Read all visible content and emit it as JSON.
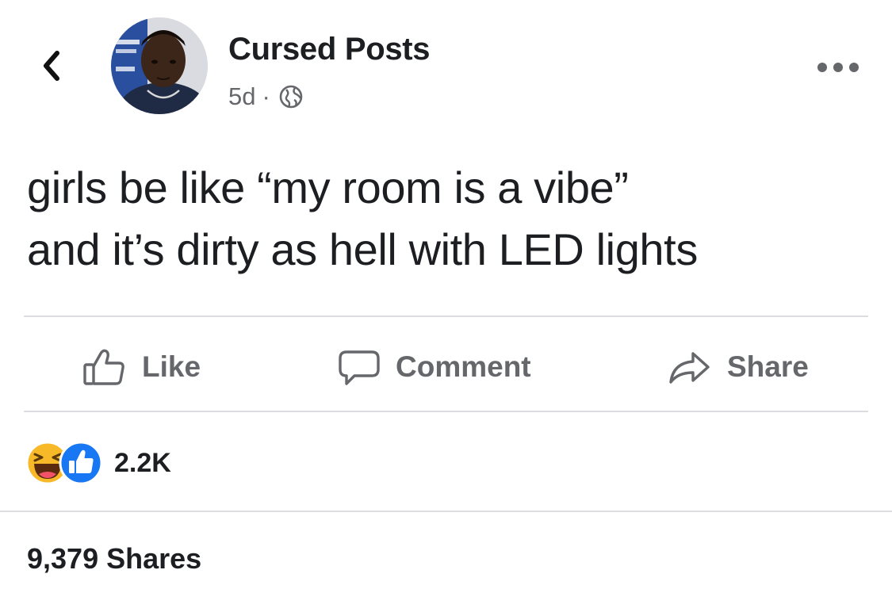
{
  "header": {
    "back_icon": "chevron-left-icon",
    "author_name": "Cursed Posts",
    "time": "5d",
    "separator": "·",
    "privacy_icon": "globe-icon",
    "more_icon": "more-horizontal-icon"
  },
  "post": {
    "text_lines": [
      "girls be like “my room is a vibe”",
      "and it’s dirty as hell with LED lights"
    ]
  },
  "actions": {
    "like": {
      "label": "Like",
      "icon": "thumbs-up-icon"
    },
    "comment": {
      "label": "Comment",
      "icon": "comment-icon"
    },
    "share": {
      "label": "Share",
      "icon": "share-arrow-icon"
    }
  },
  "reactions": {
    "icons": [
      "haha-reaction-icon",
      "like-reaction-icon"
    ],
    "count": "2.2K"
  },
  "shares": {
    "label": "9,379 Shares"
  },
  "colors": {
    "text_primary": "#1c1e21",
    "text_secondary": "#65676b",
    "divider": "#dcdde1",
    "like_blue": "#1877f2",
    "haha_yellow": "#f7b928"
  }
}
